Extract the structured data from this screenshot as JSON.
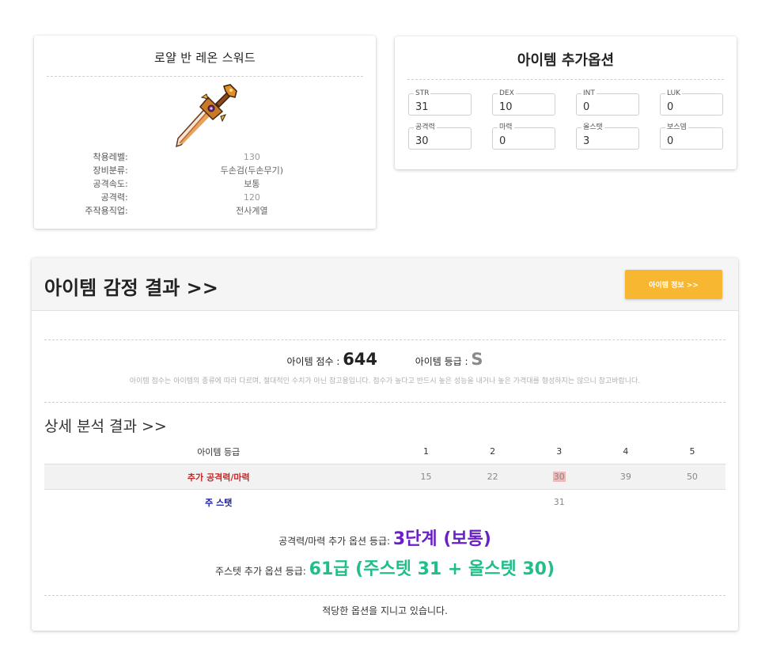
{
  "item": {
    "name": "로얄 반 레온 스워드",
    "icon": "sword-icon",
    "stats": [
      {
        "label": "착용레벨:",
        "value": "130"
      },
      {
        "label": "장비분류:",
        "value": "두손검(두손무기)"
      },
      {
        "label": "공격속도:",
        "value": "보통"
      },
      {
        "label": "공격력:",
        "value": "120"
      },
      {
        "label": "주작용직업:",
        "value": "전사계열"
      }
    ]
  },
  "options": {
    "title": "아이템 추가옵션",
    "fields": [
      {
        "label": "STR",
        "value": "31"
      },
      {
        "label": "DEX",
        "value": "10"
      },
      {
        "label": "INT",
        "value": "0"
      },
      {
        "label": "LUK",
        "value": "0"
      },
      {
        "label": "공격력",
        "value": "30"
      },
      {
        "label": "마력",
        "value": "0"
      },
      {
        "label": "올스탯",
        "value": "3"
      },
      {
        "label": "보스뎀",
        "value": "0"
      }
    ]
  },
  "result": {
    "title": "아이템 감정 결과 >>",
    "info_button": "아이템 정보 >>",
    "score_label": "아이템 점수 :",
    "score": "644",
    "grade_label": "아이템 등급 :",
    "grade": "S",
    "disclaimer": "아이템 점수는 아이템의 종류에 따라 다르며, 절대적인 수치가 아닌 참고용입니다. 점수가 높다고 반드시 높은 성능을 내거나 높은 가격대를 형성하지는 않으니 참고바랍니다.",
    "detail_title": "상세 분석 결과 >>",
    "table": {
      "header_label": "아이템 등급",
      "grades": [
        "1",
        "2",
        "3",
        "4",
        "5"
      ],
      "atk_label": "추가 공격력/마력",
      "atk_values": [
        "15",
        "22",
        "30",
        "39",
        "50"
      ],
      "main_label": "주 스탯",
      "main_value": "31"
    },
    "atk_grade_label": "공격력/마력 추가 옵션 등급:",
    "atk_grade": "3단계 (보통)",
    "main_grade_label": "주스텟 추가 옵션 등급:",
    "main_grade": "61급 (주스텟 31 + 올스텟 30)",
    "verdict": "적당한 옵션을 지니고 있습니다."
  },
  "colors": {
    "button": "#f7b731",
    "atk_label": "#c62828",
    "main_label": "#1a1aa8",
    "atk_grade": "#6a1fc9",
    "main_grade": "#1fbe8b",
    "highlight": "#f2b8b8"
  }
}
